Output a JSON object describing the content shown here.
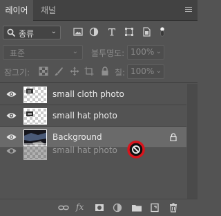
{
  "tabs": [
    {
      "label": "레이어",
      "active": true
    },
    {
      "label": "채널",
      "active": false
    }
  ],
  "filter": {
    "kind_label": "종류",
    "icons": [
      "image-filter-icon",
      "adjustment-filter-icon",
      "type-filter-icon",
      "shape-filter-icon",
      "smart-object-filter-icon",
      "filter-toggle-icon"
    ]
  },
  "blend": {
    "mode": "표준",
    "opacity_label": "불투명도:",
    "opacity_value": "100%"
  },
  "lock": {
    "label": "잠그기:",
    "icons": [
      "lock-transparent-pixels-icon",
      "lock-image-pixels-icon",
      "lock-position-icon",
      "prevent-autonest-icon",
      "lock-all-icon"
    ],
    "fill_label": "칠:",
    "fill_value": "100%"
  },
  "layers": [
    {
      "name": "small cloth photo",
      "visible": true,
      "selected": false,
      "thumb": "transparent"
    },
    {
      "name": "small hat photo",
      "visible": true,
      "selected": false,
      "thumb": "transparent"
    },
    {
      "name": "Background",
      "visible": true,
      "selected": true,
      "thumb": "photo",
      "locked": true
    }
  ],
  "drag_ghost": {
    "name": "small hat photo"
  },
  "footer_icons": [
    "link-layers-icon",
    "fx-icon",
    "add-mask-icon",
    "adjustment-layer-icon",
    "new-group-icon",
    "new-layer-icon",
    "delete-layer-icon"
  ],
  "colors": {
    "panel_bg": "#535353",
    "tabbar_bg": "#424242",
    "selected_row": "#6a6a6a",
    "no_drop_red": "#d8141c"
  }
}
